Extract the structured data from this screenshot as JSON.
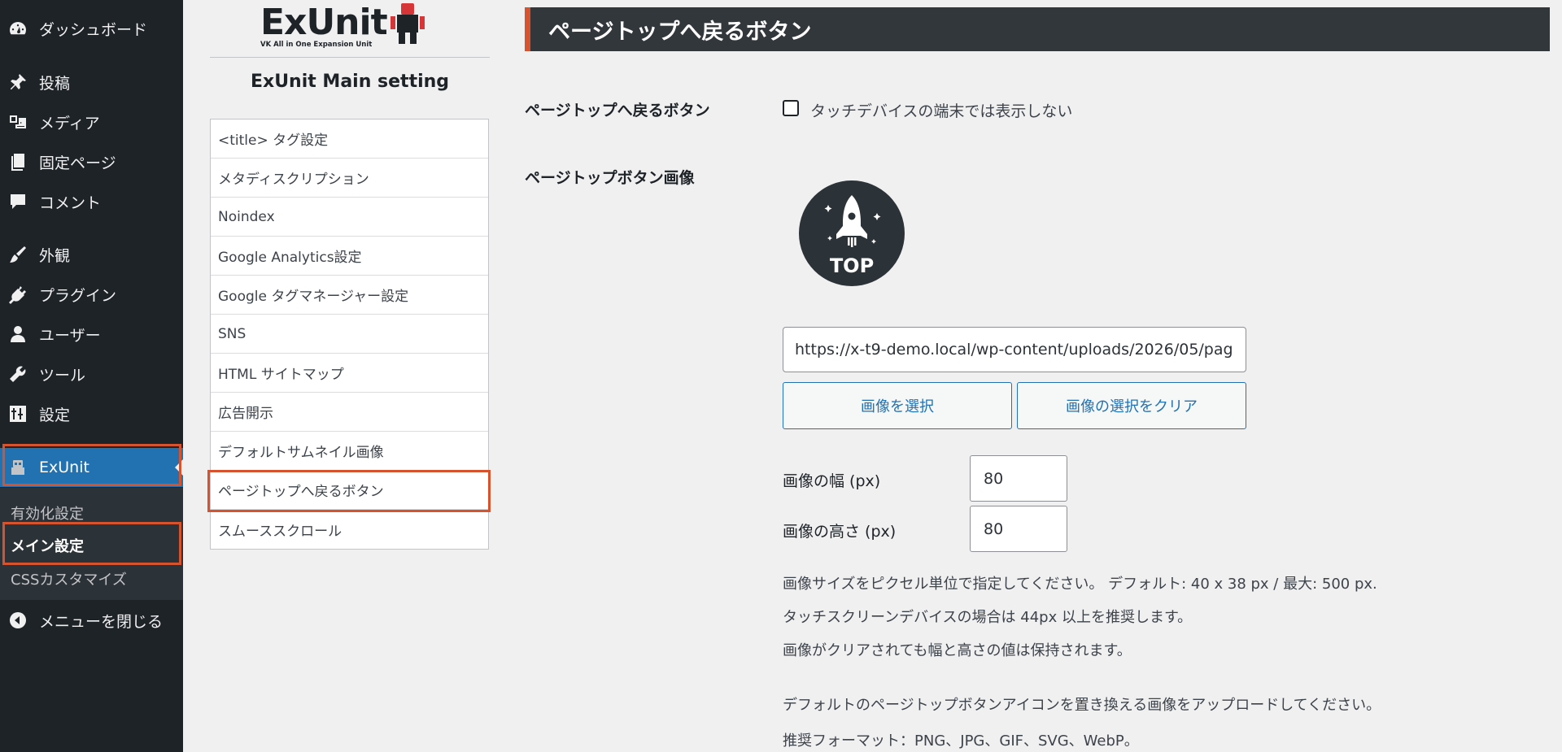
{
  "admin_menu": {
    "items": [
      {
        "label": "ダッシュボード",
        "icon": "dashboard-icon"
      },
      {
        "label": "投稿",
        "icon": "pin-icon"
      },
      {
        "label": "メディア",
        "icon": "media-icon"
      },
      {
        "label": "固定ページ",
        "icon": "page-icon"
      },
      {
        "label": "コメント",
        "icon": "comment-icon"
      },
      {
        "label": "外観",
        "icon": "brush-icon"
      },
      {
        "label": "プラグイン",
        "icon": "plugin-icon"
      },
      {
        "label": "ユーザー",
        "icon": "user-icon"
      },
      {
        "label": "ツール",
        "icon": "wrench-icon"
      },
      {
        "label": "設定",
        "icon": "settings-icon"
      }
    ],
    "exunit": {
      "label": "ExUnit",
      "icon": "exunit-robot-icon"
    },
    "submenu": [
      "有効化設定",
      "メイン設定",
      "CSSカスタマイズ"
    ],
    "collapse_label": "メニューを閉じる"
  },
  "exunit_nav": {
    "logo_text": "ExUnit",
    "logo_subtext": "VK All in One Expansion Unit",
    "title": "ExUnit Main setting",
    "items": [
      "<title> タグ設定",
      "メタディスクリプション",
      "Noindex",
      "Google Analytics設定",
      "Google タグマネージャー設定",
      "SNS",
      "HTML サイトマップ",
      "広告開示",
      "デフォルトサムネイル画像",
      "ページトップへ戻るボタン",
      "スムーススクロール"
    ]
  },
  "main": {
    "section_title": "ページトップへ戻るボタン",
    "row1_label": "ページトップへ戻るボタン",
    "touch_checkbox_label": "タッチデバイスの端末では表示しない",
    "touch_checkbox_checked": false,
    "row2_label": "ページトップボタン画像",
    "preview_text": "TOP",
    "image_url": "https://x-t9-demo.local/wp-content/uploads/2026/05/pag",
    "select_button": "画像を選択",
    "clear_button": "画像の選択をクリア",
    "width_label": "画像の幅 (px)",
    "width_value": "80",
    "height_label": "画像の高さ (px)",
    "height_value": "80",
    "desc1": "画像サイズをピクセル単位で指定してください。 デフォルト: 40 x 38 px / 最大: 500 px.",
    "desc2": "タッチスクリーンデバイスの場合は 44px 以上を推奨します。",
    "desc3": "画像がクリアされても幅と高さの値は保持されます。",
    "desc4": "デフォルトのページトップボタンアイコンを置き換える画像をアップロードしてください。",
    "desc5": "推奨フォーマット：PNG、JPG、GIF、SVG、WebP。"
  },
  "colors": {
    "admin_bg": "#1d2327",
    "admin_active": "#2271b1",
    "highlight_box": "#d6532f",
    "header_bg": "#32373c",
    "link_blue": "#2271b1"
  }
}
